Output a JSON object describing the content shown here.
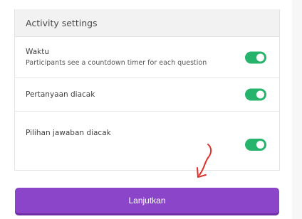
{
  "settings": {
    "title": "Activity settings",
    "rows": [
      {
        "label": "Waktu",
        "description": "Participants see a countdown timer for each question",
        "enabled": true
      },
      {
        "label": "Pertanyaan diacak",
        "enabled": true
      },
      {
        "label": "Pilihan jawaban diacak",
        "enabled": true
      }
    ]
  },
  "continue_button": {
    "label": "Lanjutkan"
  },
  "colors": {
    "toggle_on": "#26b36b",
    "button": "#8a45c8",
    "annotation": "#e0302c"
  }
}
